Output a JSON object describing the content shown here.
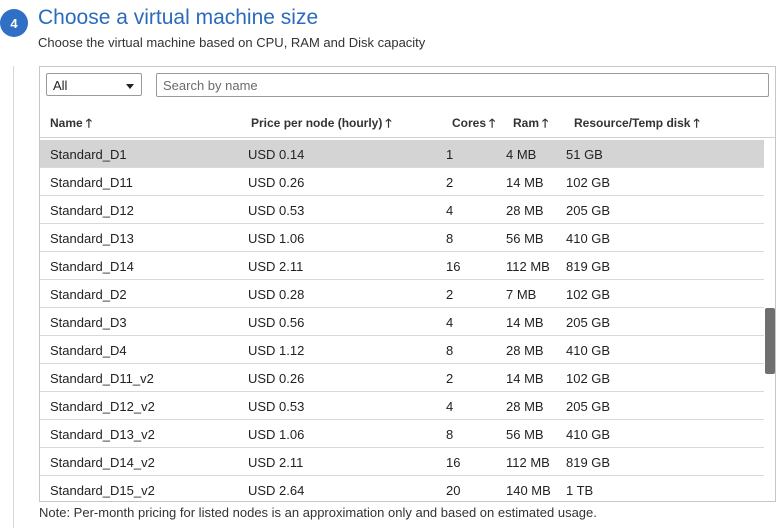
{
  "step": {
    "number": "4",
    "title": "Choose a virtual machine size",
    "subtitle": "Choose the virtual machine based on CPU, RAM and Disk capacity"
  },
  "filter": {
    "selected": "All"
  },
  "search": {
    "placeholder": "Search by name",
    "value": ""
  },
  "columns": {
    "name": "Name",
    "price": "Price per node (hourly)",
    "cores": "Cores",
    "ram": "Ram",
    "disk": "Resource/Temp disk",
    "sort_icon": "arrow-up-icon"
  },
  "rows": [
    {
      "name": "Standard_D1",
      "price": "USD 0.14",
      "cores": "1",
      "ram": "4 MB",
      "disk": "51 GB",
      "selected": true
    },
    {
      "name": "Standard_D11",
      "price": "USD 0.26",
      "cores": "2",
      "ram": "14 MB",
      "disk": "102 GB"
    },
    {
      "name": "Standard_D12",
      "price": "USD 0.53",
      "cores": "4",
      "ram": "28 MB",
      "disk": "205 GB"
    },
    {
      "name": "Standard_D13",
      "price": "USD 1.06",
      "cores": "8",
      "ram": "56 MB",
      "disk": "410 GB"
    },
    {
      "name": "Standard_D14",
      "price": "USD 2.11",
      "cores": "16",
      "ram": "112 MB",
      "disk": "819 GB"
    },
    {
      "name": "Standard_D2",
      "price": "USD 0.28",
      "cores": "2",
      "ram": "7 MB",
      "disk": "102 GB"
    },
    {
      "name": "Standard_D3",
      "price": "USD 0.56",
      "cores": "4",
      "ram": "14 MB",
      "disk": "205 GB"
    },
    {
      "name": "Standard_D4",
      "price": "USD 1.12",
      "cores": "8",
      "ram": "28 MB",
      "disk": "410 GB"
    },
    {
      "name": "Standard_D11_v2",
      "price": "USD 0.26",
      "cores": "2",
      "ram": "14 MB",
      "disk": "102 GB"
    },
    {
      "name": "Standard_D12_v2",
      "price": "USD 0.53",
      "cores": "4",
      "ram": "28 MB",
      "disk": "205 GB"
    },
    {
      "name": "Standard_D13_v2",
      "price": "USD 1.06",
      "cores": "8",
      "ram": "56 MB",
      "disk": "410 GB"
    },
    {
      "name": "Standard_D14_v2",
      "price": "USD 2.11",
      "cores": "16",
      "ram": "112 MB",
      "disk": "819 GB"
    },
    {
      "name": "Standard_D15_v2",
      "price": "USD 2.64",
      "cores": "20",
      "ram": "140 MB",
      "disk": "1 TB"
    }
  ],
  "note": "Note: Per-month pricing for listed nodes is an approximation only and based on estimated usage.",
  "colors": {
    "accent": "#2f6fc4",
    "title": "#2a6bbf",
    "selected_row": "#d4d4d4"
  }
}
